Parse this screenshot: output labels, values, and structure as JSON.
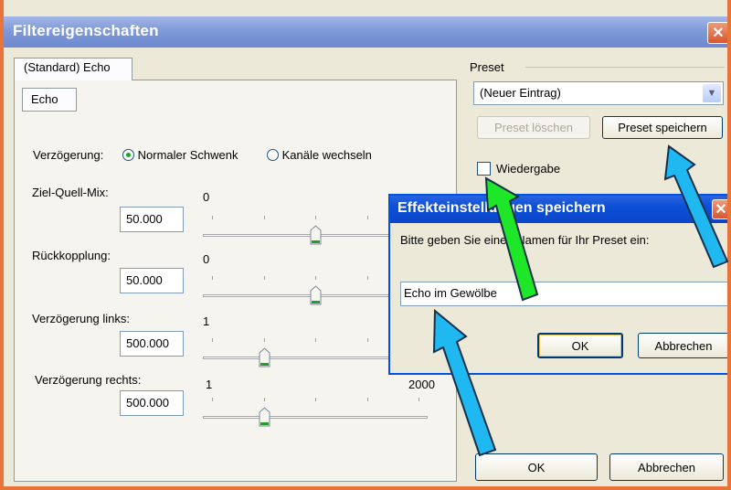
{
  "window": {
    "title": "Filtereigenschaften",
    "close_glyph": "✕"
  },
  "tabs": {
    "main": "(Standard) Echo",
    "sub": "Echo"
  },
  "delay": {
    "label": "Verzögerung:",
    "options": [
      "Normaler Schwenk",
      "Kanäle wechseln"
    ],
    "selected": "Normaler Schwenk"
  },
  "params": [
    {
      "label": "Ziel-Quell-Mix:",
      "value": "50.000",
      "scale_min": "0",
      "slider_level": 0.5
    },
    {
      "label": "Rückkopplung:",
      "value": "50.000",
      "scale_min": "0",
      "slider_level": 0.5
    },
    {
      "label": "Verzögerung links:",
      "value": "500.000",
      "scale_min": "1",
      "slider_level": 0.25
    },
    {
      "label": "Verzögerung rechts:",
      "value": "500.000",
      "scale_min": "1",
      "scale_max": "2000",
      "slider_level": 0.25
    }
  ],
  "preset": {
    "label": "Preset",
    "selected": "(Neuer Eintrag)",
    "delete_label": "Preset löschen",
    "save_label": "Preset speichern",
    "playback_label": "Wiedergabe",
    "playback_checked": false
  },
  "save_dialog": {
    "title": "Effekteinstellungen speichern",
    "prompt": "Bitte geben Sie einen Namen für Ihr Preset ein:",
    "input_value": "Echo im Gewölbe",
    "ok_label": "OK",
    "cancel_label": "Abbrechen"
  },
  "footer": {
    "ok_label": "OK",
    "cancel_label": "Abbrechen"
  },
  "colors": {
    "titlebar": "#7f9ad8",
    "dialog_titlebar": "#0d4fd8",
    "arrow_cyan": "#1fb8f0",
    "arrow_green": "#1ee628",
    "frame_orange": "#e8743a"
  }
}
